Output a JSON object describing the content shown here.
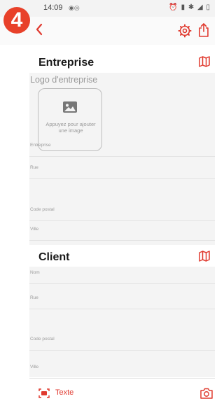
{
  "status_bar": {
    "time": "14:09",
    "notification_icons": "◉◎",
    "system_icons": "⏰ ▮ ✱ ◢ ▯"
  },
  "step_badge": "4",
  "entreprise": {
    "title": "Entreprise",
    "logo_label": "Logo d'entreprise",
    "logo_hint": "Appuyez pour ajouter une image",
    "fields": [
      "Entreprise",
      "Rue",
      "Code postal",
      "Ville"
    ]
  },
  "client": {
    "title": "Client",
    "fields": [
      "Nom",
      "Rue",
      "Code postal",
      "Ville"
    ]
  },
  "bottom_bar": {
    "text_button_label": "Texte"
  },
  "colors": {
    "accent": "#e03a2f",
    "badge": "#e8412a",
    "panel_bg": "#f4f4f4"
  }
}
